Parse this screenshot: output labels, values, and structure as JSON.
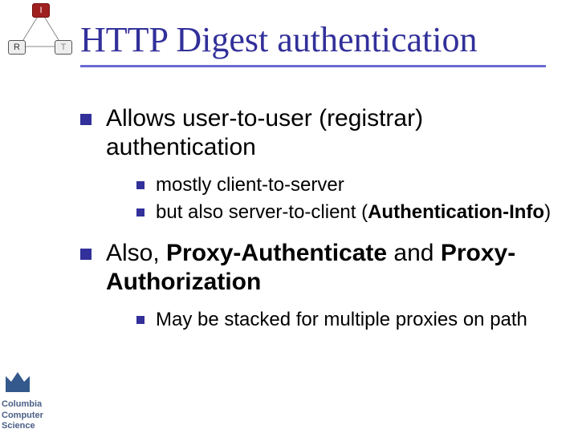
{
  "title": "HTTP Digest authentication",
  "diagram": {
    "nodes": {
      "I": "I",
      "R": "R",
      "T": "T"
    }
  },
  "bullets": {
    "a": {
      "text": "Allows user-to-user (registrar) authentication",
      "sub": {
        "s1": "mostly client-to-server",
        "s2_pre": "but also server-to-client (",
        "s2_bold": "Authentication-Info",
        "s2_post": ")"
      }
    },
    "b": {
      "pre": "Also, ",
      "bold1": "Proxy-Authenticate",
      "mid": " and ",
      "bold2": "Proxy-Authorization",
      "sub": {
        "s1": "May be stacked for multiple proxies on path"
      }
    }
  },
  "logo": {
    "line1": "Columbia",
    "line2": "Computer",
    "line3": "Science"
  }
}
